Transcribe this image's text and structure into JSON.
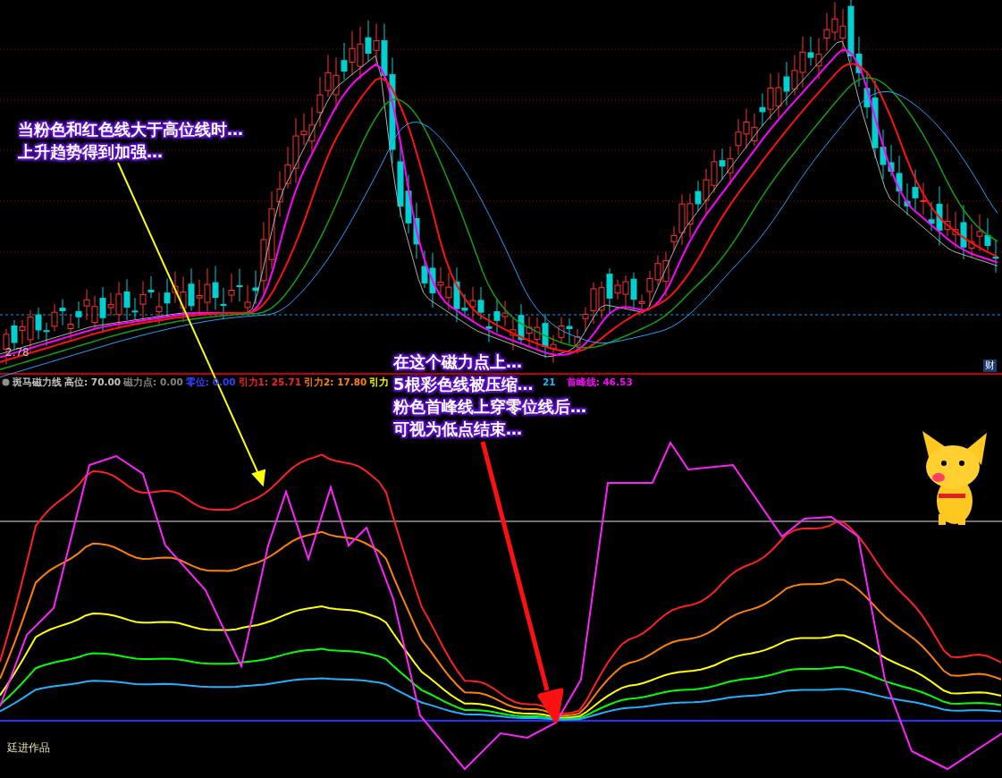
{
  "main_chart": {
    "price_label": "2.78",
    "finance_button": "财"
  },
  "indicator": {
    "legend": [
      {
        "text": "斑马磁力线",
        "color": "#c0c0c0"
      },
      {
        "text": "高位: 70.00",
        "color": "#c0c0c0"
      },
      {
        "text": "磁力点: 0.00",
        "color": "#808080"
      },
      {
        "text": "零位: 0.00",
        "color": "#3040ff"
      },
      {
        "text": "引力1: 25.71",
        "color": "#ff2020"
      },
      {
        "text": "引力2: 17.80",
        "color": "#ff8000"
      },
      {
        "text": "引力",
        "color": "#ffff00"
      },
      {
        "text": "21",
        "color": "#00c0ff"
      },
      {
        "text": "首峰线: 46.53",
        "color": "#ff00ff"
      }
    ],
    "credit": "廷进作品"
  },
  "callouts": [
    {
      "lines": [
        "当粉色和红色线大于高位线时…",
        "上升趋势得到加强…"
      ]
    },
    {
      "lines": [
        "在这个磁力点上…",
        "5根彩色线被压缩…",
        "粉色首峰线上穿零位线后…",
        "可视为低点结束…"
      ]
    }
  ]
}
